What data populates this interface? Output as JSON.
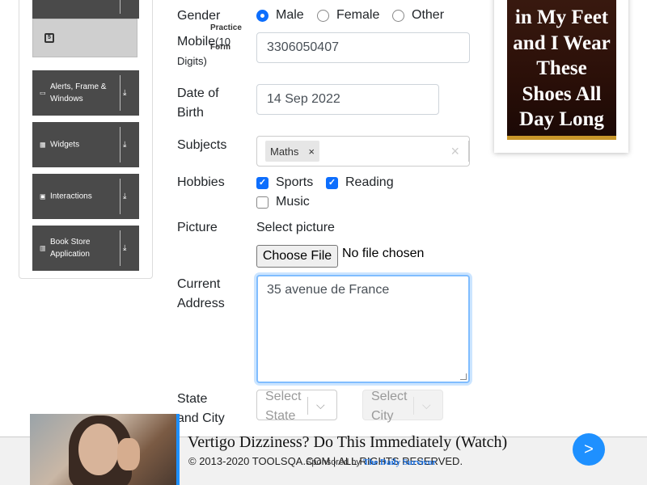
{
  "sidebar": {
    "practice_form": "Practice Form",
    "groups": [
      {
        "label": "Alerts, Frame & Windows"
      },
      {
        "label": "Widgets"
      },
      {
        "label": "Interactions"
      },
      {
        "label": "Book Store Application"
      }
    ]
  },
  "form": {
    "gender_label": "Gender",
    "gender_options": [
      "Male",
      "Female",
      "Other"
    ],
    "gender_selected": "Male",
    "mobile_label": "Mobile",
    "mobile_hint": "(10 Digits)",
    "mobile_value": "3306050407",
    "dob_label_1": "Date of",
    "dob_label_2": "Birth",
    "dob_value": "14 Sep 2022",
    "subjects_label": "Subjects",
    "subject_tag": "Maths",
    "hobbies_label": "Hobbies",
    "hobbies": [
      {
        "label": "Sports",
        "checked": true
      },
      {
        "label": "Reading",
        "checked": true
      },
      {
        "label": "Music",
        "checked": false
      }
    ],
    "picture_label": "Picture",
    "picture_prompt": "Select picture",
    "choose_file": "Choose File",
    "no_file": "No file chosen",
    "address_label_1": "Current",
    "address_label_2": "Address",
    "address_value": "35 avenue de France",
    "state_label_1": "State",
    "state_label_2": "and City",
    "state_placeholder_1": "Select",
    "state_placeholder_2": "State",
    "city_placeholder_1": "Select",
    "city_placeholder_2": "City"
  },
  "ad": {
    "lines": [
      "in My Feet",
      "and I Wear",
      "These",
      "Shoes All",
      "Day Long"
    ]
  },
  "footer": {
    "copyright": "© 2013-2020 TOOLSQA.COM | ALL RIGHTS RESERVED.",
    "banner_title": "Vertigo Dizziness? Do This Immediately (Watch)",
    "sponsored_prefix": "Sponsored by",
    "sponsor": "The Daily Survivor",
    "go": ">"
  },
  "colors": {
    "accent": "#0d6efd",
    "sidebar_group": "#4a4a4a",
    "banner_blue": "#1e90ff"
  }
}
